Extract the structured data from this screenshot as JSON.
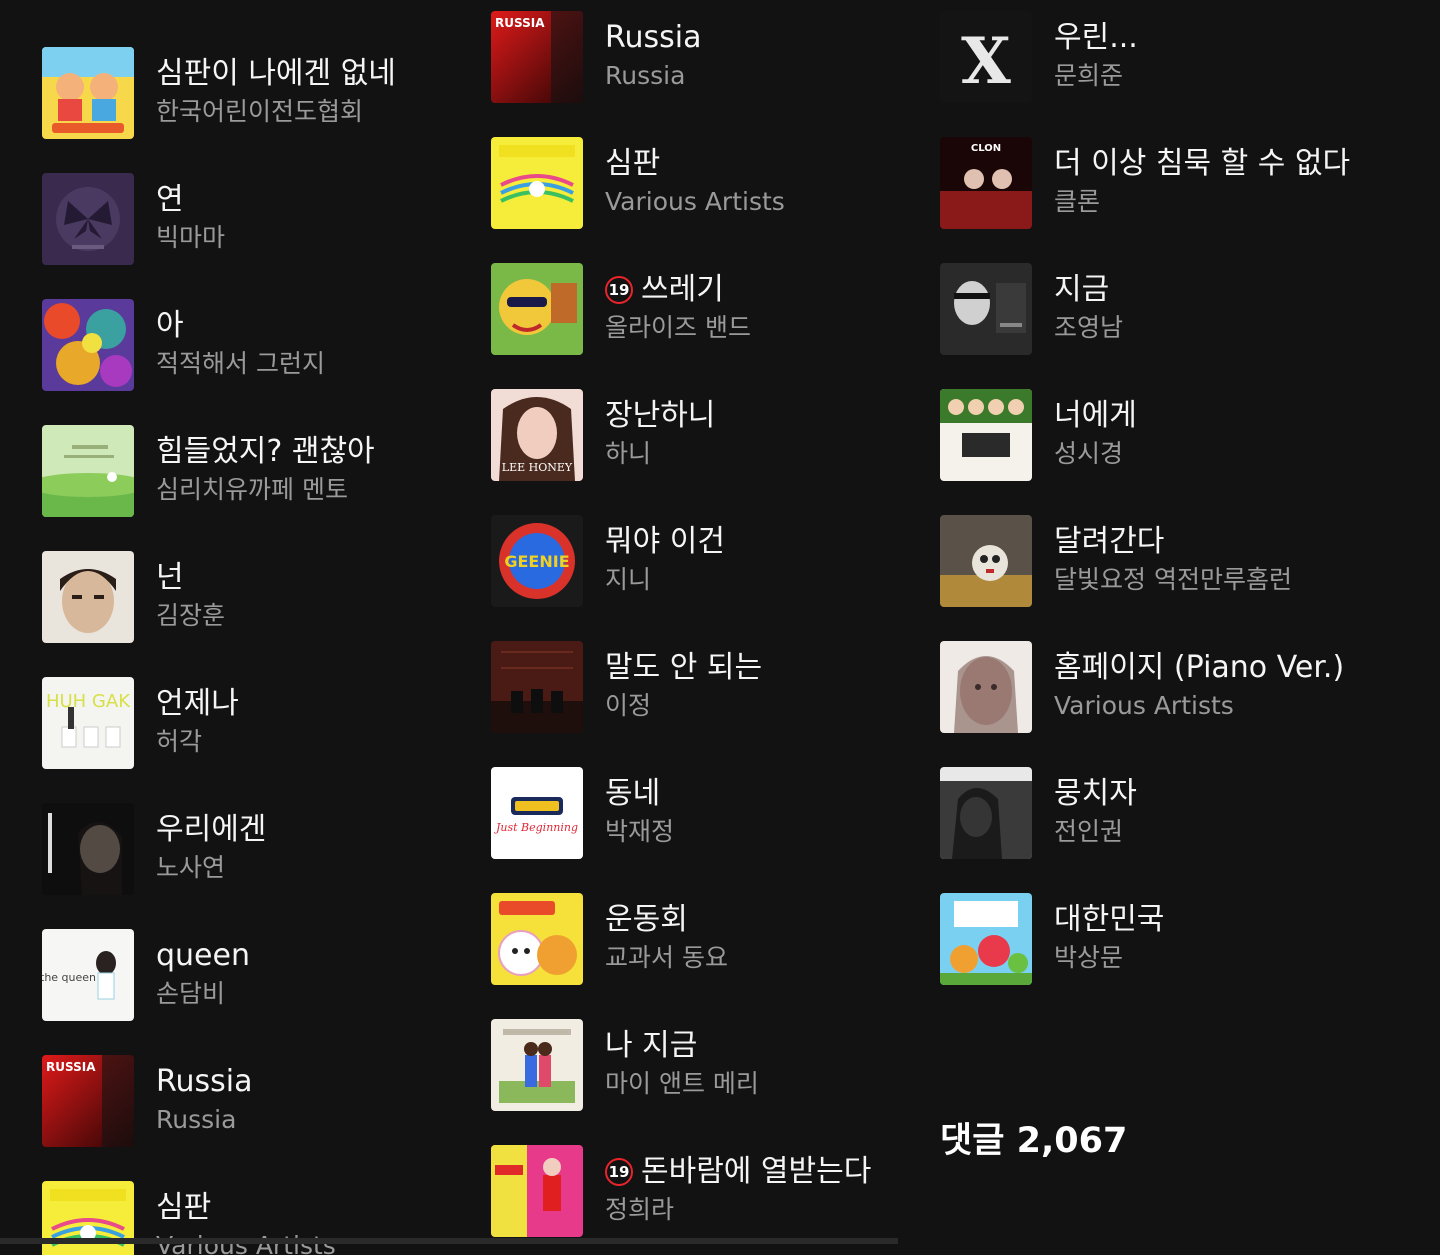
{
  "columns": [
    {
      "items": [
        {
          "title": "심판이 나에겐 없네",
          "artist": "한국어린이전도협회",
          "adult": false,
          "cover": "kids"
        },
        {
          "title": "연",
          "artist": "빅마마",
          "adult": false,
          "cover": "purple-butterfly"
        },
        {
          "title": "아",
          "artist": "적적해서 그런지",
          "adult": false,
          "cover": "colorful-abstract"
        },
        {
          "title": "힘들었지? 괜찮아",
          "artist": "심리치유까페 멘토",
          "adult": false,
          "cover": "green-field"
        },
        {
          "title": "넌",
          "artist": "김장훈",
          "adult": false,
          "cover": "portrait-man"
        },
        {
          "title": "언제나",
          "artist": "허각",
          "adult": false,
          "cover": "white-chairs"
        },
        {
          "title": "우리에겐",
          "artist": "노사연",
          "adult": false,
          "cover": "dark-portrait"
        },
        {
          "title": "queen",
          "artist": "손담비",
          "adult": false,
          "cover": "queen"
        },
        {
          "title": "Russia",
          "artist": "Russia",
          "adult": false,
          "cover": "russia"
        },
        {
          "title": "심판",
          "artist": "Various Artists",
          "adult": false,
          "cover": "yellow-music"
        }
      ]
    },
    {
      "items": [
        {
          "title": "Russia",
          "artist": "Russia",
          "adult": false,
          "cover": "russia"
        },
        {
          "title": "심판",
          "artist": "Various Artists",
          "adult": false,
          "cover": "yellow-music"
        },
        {
          "title": "쓰레기",
          "artist": "올라이즈 밴드",
          "adult": true,
          "cover": "cartoon"
        },
        {
          "title": "장난하니",
          "artist": "하니",
          "adult": false,
          "cover": "lee-honey"
        },
        {
          "title": "뭐야 이건",
          "artist": "지니",
          "adult": false,
          "cover": "geenie"
        },
        {
          "title": "말도 안 되는",
          "artist": "이정",
          "adult": false,
          "cover": "brick-room"
        },
        {
          "title": "동네",
          "artist": "박재정",
          "adult": false,
          "cover": "just-beginning"
        },
        {
          "title": "운동회",
          "artist": "교과서 동요",
          "adult": false,
          "cover": "school-song"
        },
        {
          "title": "나 지금",
          "artist": "마이 앤트 메리",
          "adult": false,
          "cover": "couple-illustration"
        },
        {
          "title": "돈바람에 열받는다",
          "artist": "정희라",
          "adult": true,
          "cover": "trot-girl"
        }
      ]
    },
    {
      "items": [
        {
          "title": "우린...",
          "artist": "문희준",
          "adult": false,
          "cover": "x-logo"
        },
        {
          "title": "더 이상 침묵 할 수 없다",
          "artist": "클론",
          "adult": false,
          "cover": "clon"
        },
        {
          "title": "지금",
          "artist": "조영남",
          "adult": false,
          "cover": "bw-man-guitar"
        },
        {
          "title": "너에게",
          "artist": "성시경",
          "adult": false,
          "cover": "group-photo"
        },
        {
          "title": "달려간다",
          "artist": "달빛요정 역전만루홈런",
          "adult": false,
          "cover": "doll"
        },
        {
          "title": "홈페이지 (Piano Ver.)",
          "artist": "Various Artists",
          "adult": false,
          "cover": "painting-girl"
        },
        {
          "title": "뭉치자",
          "artist": "전인권",
          "adult": false,
          "cover": "bw-longhair"
        },
        {
          "title": "대한민국",
          "artist": "박상문",
          "adult": false,
          "cover": "balloon-kids"
        }
      ]
    }
  ],
  "age_badge_label": "19",
  "comments": {
    "label": "댓글 2,067"
  },
  "cover_texts": {
    "russia": "RUSSIA",
    "lee_honey": "LEE HONEY",
    "geenie": "GEENIE",
    "x_logo": "X",
    "clon": "CLON",
    "queen": "the queen",
    "just_beginning": "Just Beginning",
    "huh_gak": "HUH GAK"
  },
  "colors": {
    "background": "#121212",
    "title": "#f5f5f5",
    "artist": "#9a9a9a",
    "badge_ring": "#e8242b"
  }
}
